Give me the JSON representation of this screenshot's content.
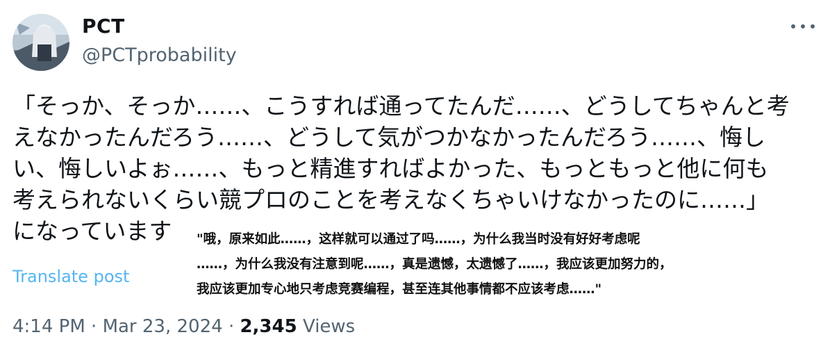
{
  "author": {
    "display_name": "PCT",
    "handle": "@PCTprobability"
  },
  "menu": {
    "more_icon": "more-horizontal-icon"
  },
  "post": {
    "lines": [
      "「そっか、そっか……、こうすれば通ってたんだ……、どうしてちゃんと考",
      "えなかったんだろう……、どうして気がつかなかったんだろう……、悔し",
      "い、悔しいよぉ……、もっと精進すればよかった、もっともっと他に何も",
      "考えられないくらい競プロのことを考えなくちゃいけなかったのに……」",
      "になっています"
    ]
  },
  "overlay_translation": {
    "lines": [
      "\"哦，原来如此……，这样就可以通过了吗……，为什么我当时没有好好考虑呢",
      "……，为什么我没有注意到呢……，真是遗憾，太遗憾了……，我应该更加努力的，",
      "我应该更加专心地只考虑竞赛编程，甚至连其他事情都不应该考虑……\""
    ]
  },
  "translate_label": "Translate post",
  "meta": {
    "time": "4:14 PM",
    "separator": "·",
    "date": "Mar 23, 2024",
    "views_count": "2,345",
    "views_label": "Views"
  },
  "colors": {
    "text_primary": "#0f1419",
    "text_secondary": "#536471",
    "link": "#1d9bf0"
  }
}
